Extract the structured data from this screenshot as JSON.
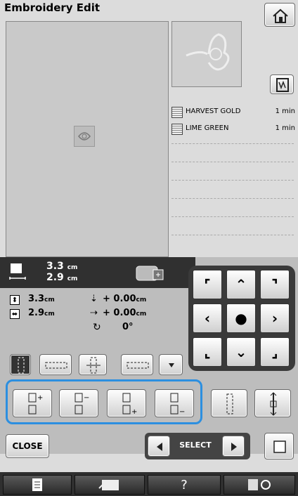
{
  "title": "Embroidery Edit",
  "threads": [
    {
      "name": "HARVEST GOLD",
      "time": "1 min"
    },
    {
      "name": "LIME GREEN",
      "time": "1 min"
    }
  ],
  "size": {
    "width": "3.3",
    "height": "2.9",
    "unit": "cm"
  },
  "dims": {
    "height": "3.3",
    "width": "2.9",
    "unit": "cm"
  },
  "offset": {
    "v": "+ 0.00",
    "h": "+ 0.00",
    "unit": "cm"
  },
  "rotation": "0°",
  "close_label": "CLOSE",
  "select_label": "SELECT",
  "help_label": "?",
  "colors": {
    "highlight": "#2c8fe0",
    "bar": "#2f2f2f"
  }
}
